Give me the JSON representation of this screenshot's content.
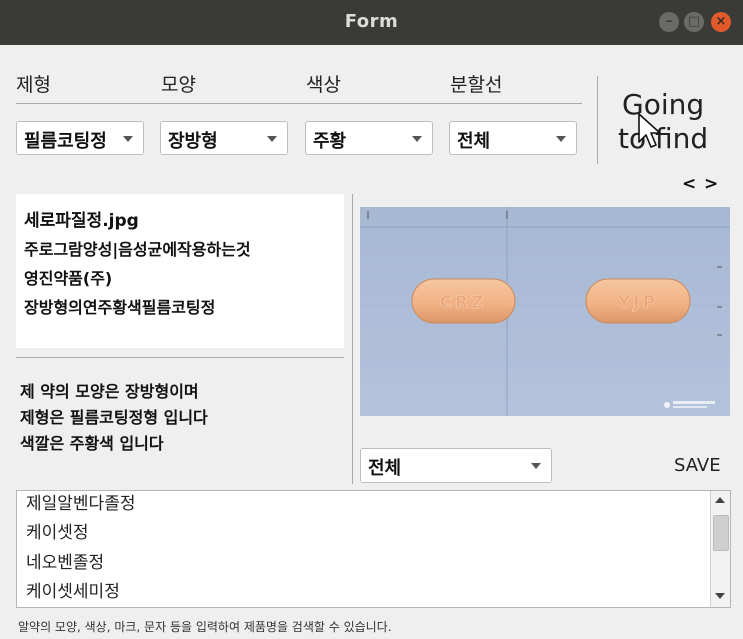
{
  "window": {
    "title": "Form"
  },
  "headers": [
    "제형",
    "모양",
    "색상",
    "분할선"
  ],
  "filters": {
    "formulation": "필름코팅정",
    "shape": "장방형",
    "color": "주황",
    "split_line": "전체"
  },
  "going_to_find": {
    "line1": "Going",
    "line2": "to find"
  },
  "nav": {
    "prev": "<",
    "next": ">"
  },
  "info": {
    "filename": "세로파질정.jpg",
    "effect": "주로그람양성|음성균에작용하는것",
    "company": "영진약품(주)",
    "appearance": "장방형의연주황색필름코팅정"
  },
  "description": [
    "제 약의 모양은 장방형이며",
    "제형은 필름코팅정형 입니다",
    "색깔은 주황색 입니다"
  ],
  "image": {
    "pill_marks": [
      "CRZ",
      "YJP"
    ],
    "pill_color": "#f2b48a",
    "background": "#a9bbd6"
  },
  "image_filter": "전체",
  "save_label": "SAVE",
  "list_items": [
    "제일알벤다졸정",
    "케이셋정",
    "네오벤졸정",
    "케이셋세미정"
  ],
  "status": "알약의 모양, 색상, 마크, 문자 등을 입력하여 제품명을 검색할 수 있습니다."
}
